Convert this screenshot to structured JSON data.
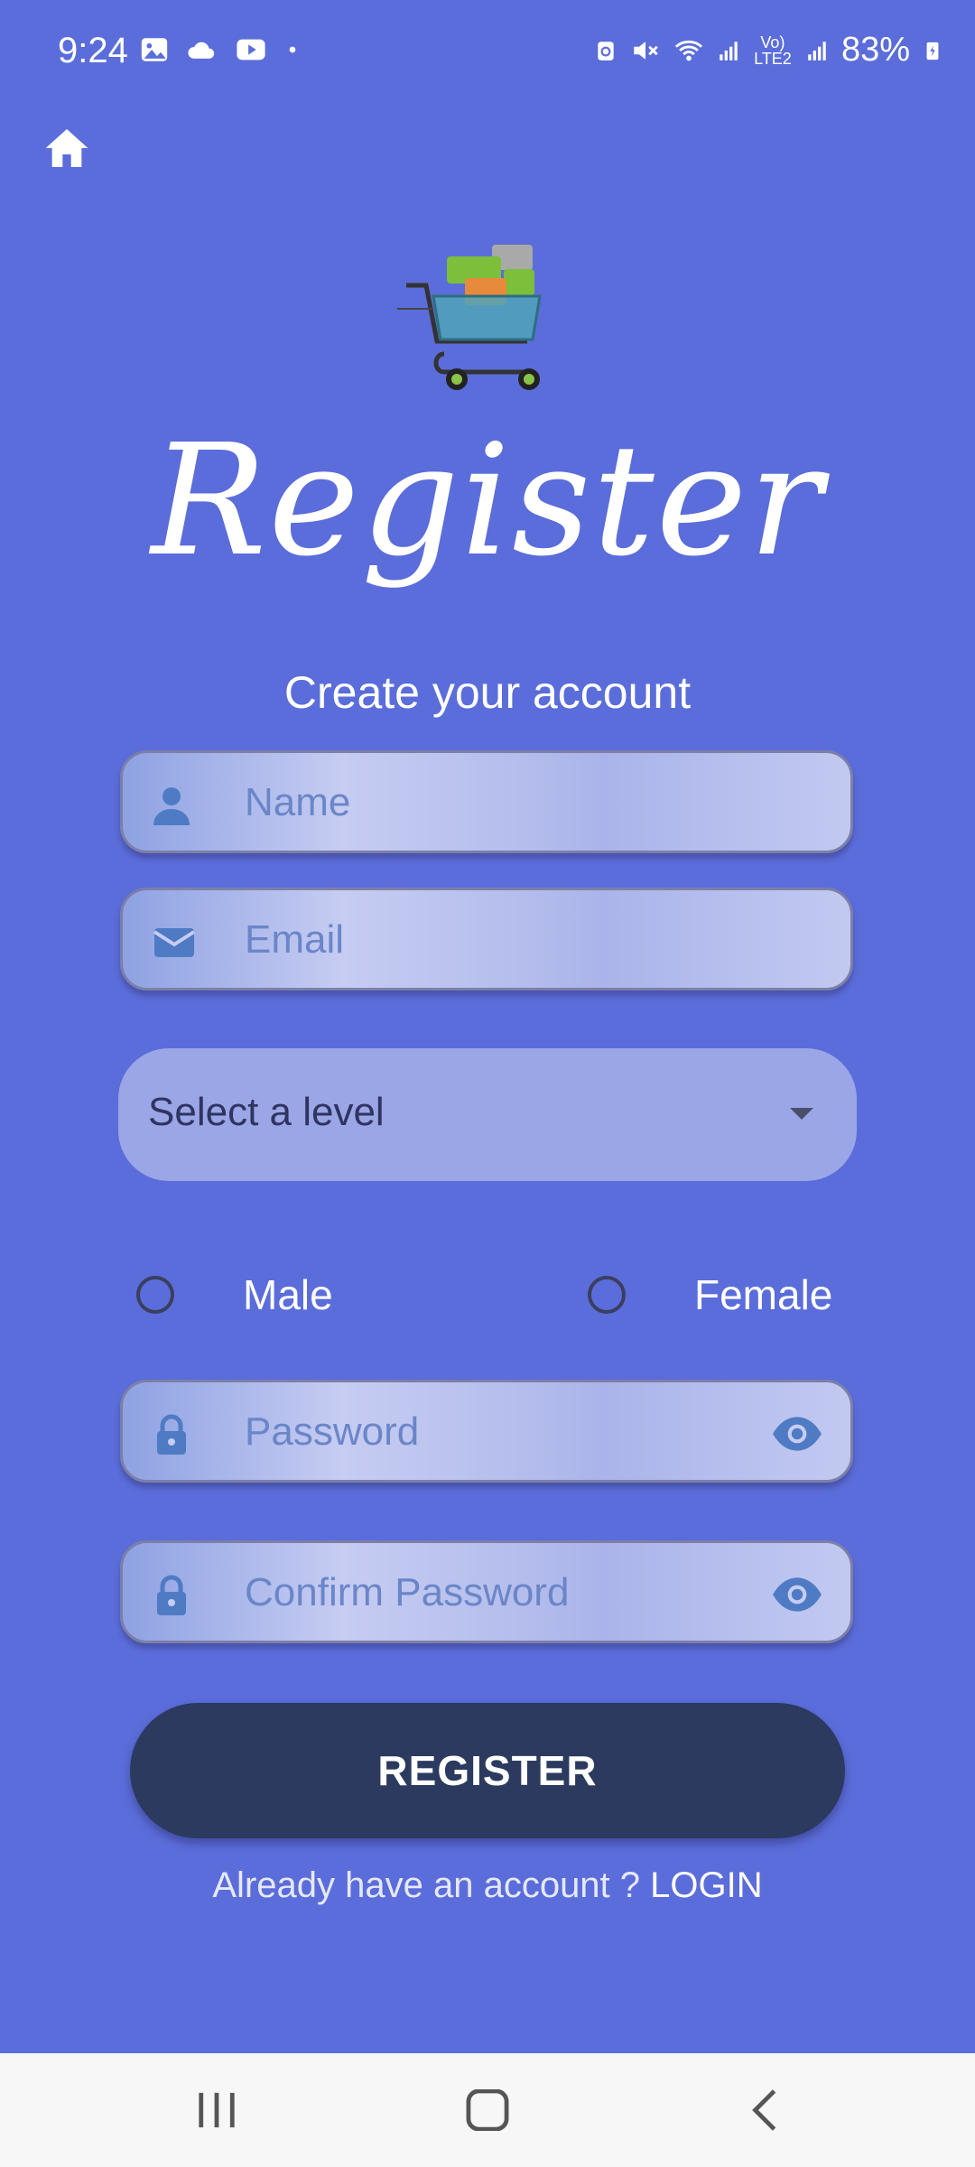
{
  "status": {
    "time": "9:24",
    "battery": "83%",
    "network_label": "Vo) LTE2",
    "icons_left": [
      "gallery-icon",
      "cloud-icon",
      "youtube-icon",
      "dot-icon"
    ],
    "icons_right": [
      "battery-saver-icon",
      "mute-icon",
      "wifi-icon",
      "signal-icon",
      "lte-icon",
      "signal-icon",
      "battery-icon"
    ]
  },
  "header": {
    "home_icon": "home-icon"
  },
  "page": {
    "title": "Register",
    "subtitle": "Create your account"
  },
  "form": {
    "name_placeholder": "Name",
    "email_placeholder": "Email",
    "level_placeholder": "Select a level",
    "gender_options": [
      "Male",
      "Female"
    ],
    "password_placeholder": "Password",
    "confirm_password_placeholder": "Confirm Password",
    "register_label": "REGISTER",
    "login_prompt": "Already have an account ? ",
    "login_link": "LOGIN"
  },
  "colors": {
    "background": "#5b6dda",
    "button": "#2b3a5e",
    "icon": "#4f7bc4",
    "placeholder": "#6b86c8"
  }
}
